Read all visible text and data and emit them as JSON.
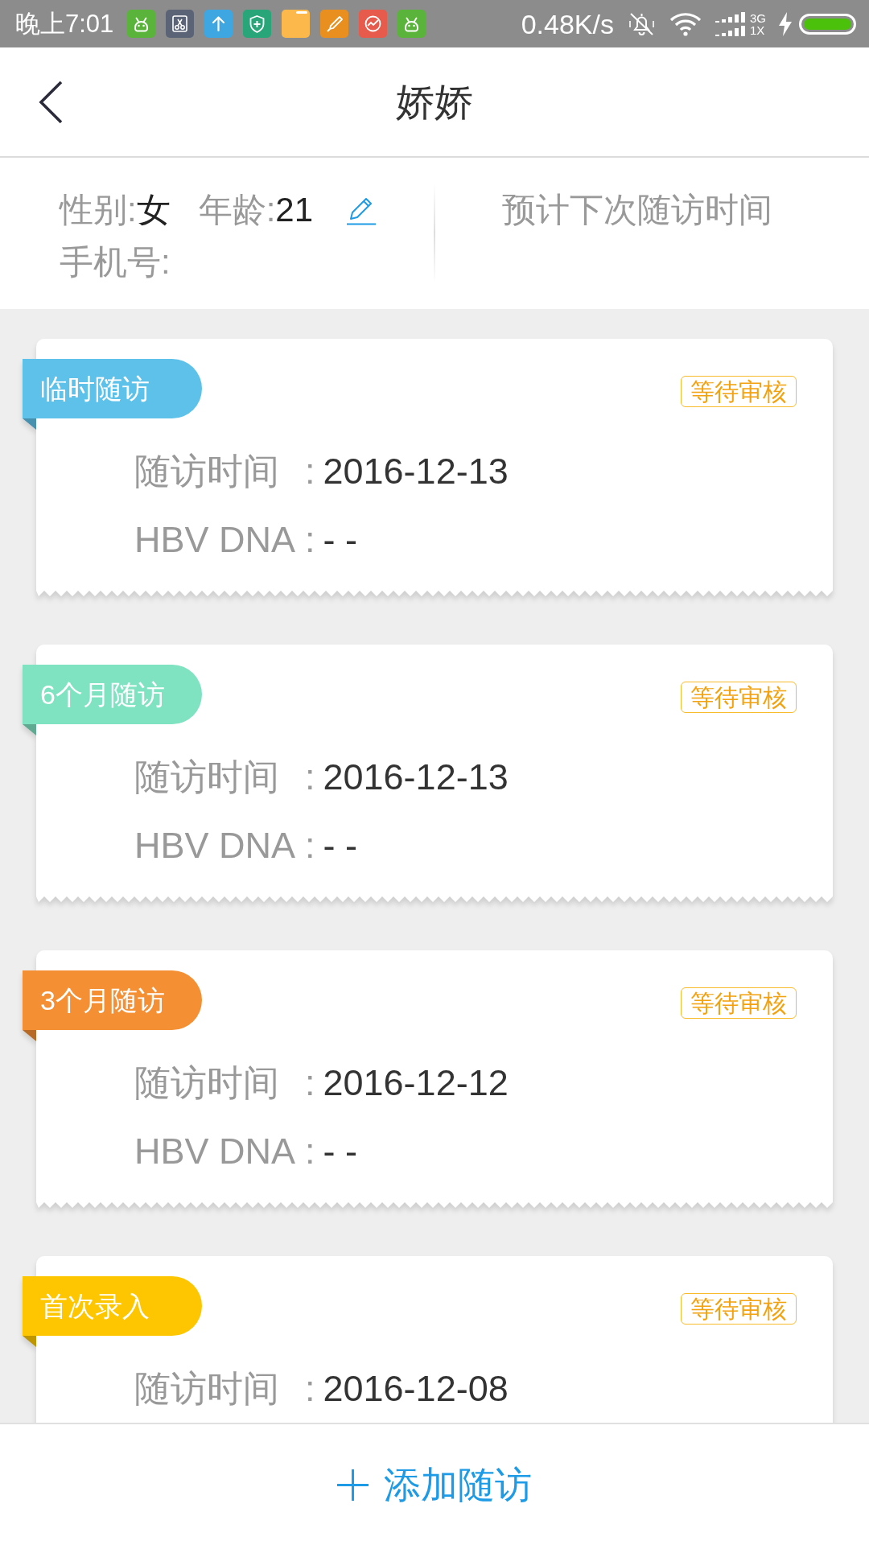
{
  "status_bar": {
    "time": "晚上7:01",
    "network_speed": "0.48K/s",
    "network_type": [
      "3G",
      "1X"
    ]
  },
  "header": {
    "title": "娇娇"
  },
  "patient": {
    "gender_label": "性别:",
    "gender": "女",
    "age_label": "年龄:",
    "age": "21",
    "phone_label": "手机号:",
    "next_visit_label": "预计下次随访时间"
  },
  "visits": [
    {
      "tag": "临时随访",
      "color": "#5ec1ea",
      "status": "等待审核",
      "fields": [
        {
          "label": "随访时间",
          "separator": ":",
          "value": "2016-12-13"
        },
        {
          "label": "HBV DNA",
          "separator": ":",
          "value": "- -"
        }
      ]
    },
    {
      "tag": "6个月随访",
      "color": "#7fe2c1",
      "status": "等待审核",
      "fields": [
        {
          "label": "随访时间",
          "separator": ":",
          "value": "2016-12-13"
        },
        {
          "label": "HBV DNA",
          "separator": ":",
          "value": "- -"
        }
      ]
    },
    {
      "tag": "3个月随访",
      "color": "#f58f33",
      "status": "等待审核",
      "fields": [
        {
          "label": "随访时间",
          "separator": ":",
          "value": "2016-12-12"
        },
        {
          "label": "HBV DNA",
          "separator": ":",
          "value": "- -"
        }
      ]
    },
    {
      "tag": "首次录入",
      "color": "#fec600",
      "status": "等待审核",
      "fields": [
        {
          "label": "随访时间",
          "separator": ":",
          "value": "2016-12-08"
        }
      ]
    }
  ],
  "add_button": {
    "label": "添加随访"
  }
}
